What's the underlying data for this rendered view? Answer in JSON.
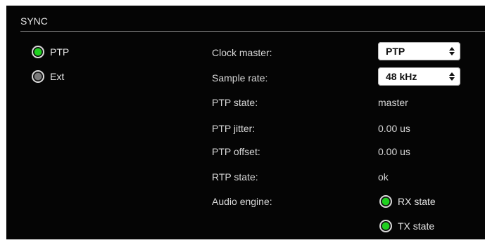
{
  "section": {
    "title": "SYNC"
  },
  "sync_source": {
    "options": [
      {
        "label": "PTP",
        "selected": true,
        "indicator_color": "#20d020"
      },
      {
        "label": "Ext",
        "selected": false,
        "indicator_color": "#7a7a7a"
      }
    ]
  },
  "settings": {
    "clock_master": {
      "label": "Clock master:",
      "value": "PTP"
    },
    "sample_rate": {
      "label": "Sample rate:",
      "value": "48 kHz"
    },
    "ptp_state": {
      "label": "PTP state:",
      "value": "master"
    },
    "ptp_jitter": {
      "label": "PTP jitter:",
      "value": "0.00 us"
    },
    "ptp_offset": {
      "label": "PTP offset:",
      "value": "0.00 us"
    },
    "rtp_state": {
      "label": "RTP state:",
      "value": "ok"
    },
    "audio_engine": {
      "label": "Audio engine:",
      "rx_state": {
        "label": "RX state",
        "indicator_color": "#20d020"
      },
      "tx_state": {
        "label": "TX state",
        "indicator_color": "#20d020"
      }
    }
  }
}
